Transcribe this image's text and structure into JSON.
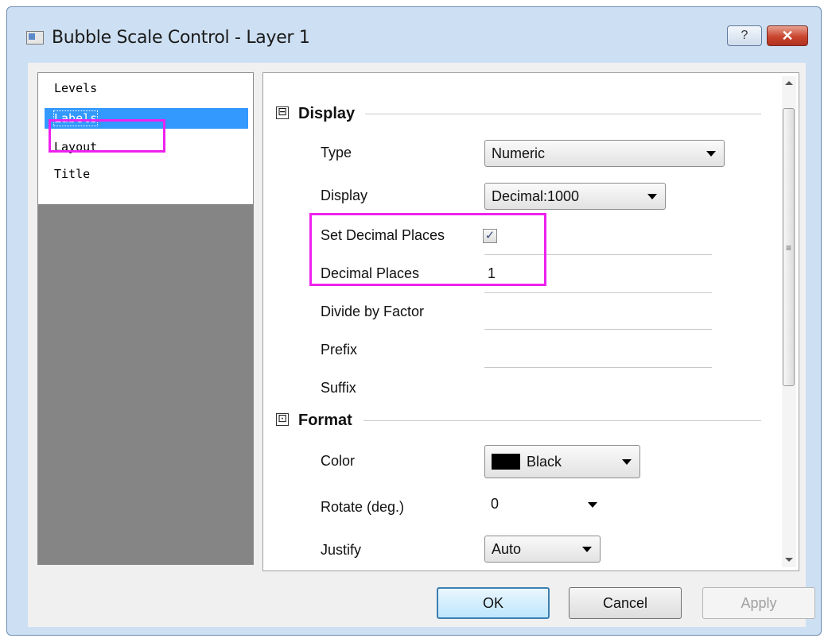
{
  "window": {
    "title": "Bubble Scale Control - Layer 1",
    "help_label": "?",
    "close_label": "✕"
  },
  "tree": {
    "items": [
      "Levels",
      "Labels",
      "Layout",
      "Title"
    ],
    "selected": "Labels"
  },
  "sections": {
    "display": {
      "title": "Display",
      "collapse_symbol": "⊟",
      "props": {
        "type_label": "Type",
        "type_value": "Numeric",
        "display_label": "Display",
        "display_value": "Decimal:1000",
        "set_decimal_label": "Set Decimal Places",
        "set_decimal_checked": "✓",
        "decimal_places_label": "Decimal Places",
        "decimal_places_value": "1",
        "divide_label": "Divide by Factor",
        "prefix_label": "Prefix",
        "suffix_label": "Suffix"
      }
    },
    "format": {
      "title": "Format",
      "collapse_symbol": "⊡",
      "props": {
        "color_label": "Color",
        "color_value": "Black",
        "rotate_label": "Rotate (deg.)",
        "rotate_value": "0",
        "justify_label": "Justify",
        "justify_value": "Auto"
      }
    }
  },
  "scrollbar": {
    "grip": "≡"
  },
  "buttons": {
    "ok": "OK",
    "cancel": "Cancel",
    "apply": "Apply"
  },
  "colors": {
    "highlight": "#ee22ee",
    "selection": "#3399ff",
    "swatch": "#000000"
  }
}
